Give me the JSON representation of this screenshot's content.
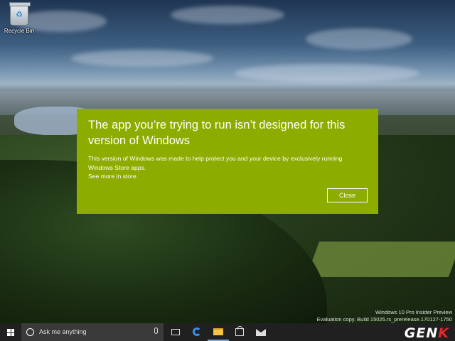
{
  "desktop": {
    "recycle_bin_label": "Recycle Bin"
  },
  "dialog": {
    "title": "The app you’re trying to run isn’t designed for this version of Windows",
    "body": "This version of Windows was made to help protect you and your device by exclusively running Windows Store apps.",
    "link": "See more in store",
    "close_label": "Close",
    "background_color": "#8cac00"
  },
  "watermark": {
    "line1": "Windows 10 Pro Insider Preview",
    "line2": "Evaluation copy. Build 15025.rs_prerelease.170127-1750"
  },
  "taskbar": {
    "search_placeholder": "Ask me anything",
    "icons": [
      "windows-logo-icon",
      "cortana-icon",
      "microphone-icon",
      "task-view-icon",
      "edge-icon",
      "file-explorer-icon",
      "store-icon",
      "mail-icon"
    ]
  },
  "logo": {
    "text_main": "GEN",
    "text_accent": "K"
  }
}
